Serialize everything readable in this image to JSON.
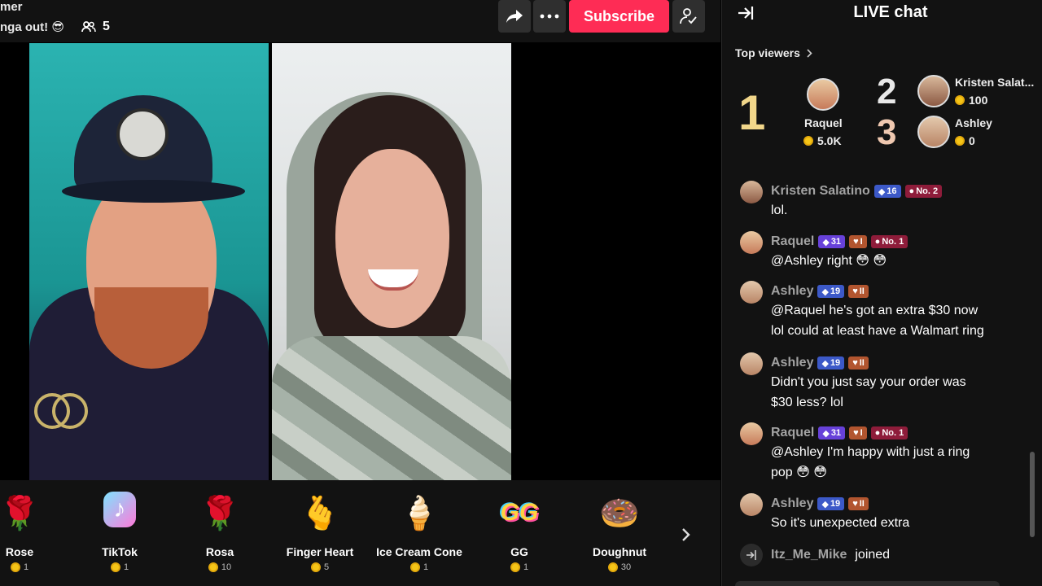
{
  "header": {
    "host_name": "mer",
    "stream_title": "nga out! 😎",
    "viewer_count": "5",
    "subscribe_label": "Subscribe"
  },
  "gifts": [
    {
      "icon": "🌹",
      "label": "Rose",
      "price": "1"
    },
    {
      "icon": "♪",
      "label": "TikTok",
      "price": "1"
    },
    {
      "icon": "🌹",
      "label": "Rosa",
      "price": "10"
    },
    {
      "icon": "🫰",
      "label": "Finger Heart",
      "price": "5"
    },
    {
      "icon": "🍦",
      "label": "Ice Cream Cone",
      "price": "1"
    },
    {
      "icon": "GG",
      "label": "GG",
      "price": "1"
    },
    {
      "icon": "🍩",
      "label": "Doughnut",
      "price": "30"
    }
  ],
  "chat": {
    "title": "LIVE chat",
    "top_viewers_label": "Top viewers",
    "top_viewers": [
      {
        "rank": "1",
        "name": "Raquel",
        "coins": "5.0K"
      },
      {
        "rank": "2",
        "name": "Kristen Salat...",
        "coins": "100"
      },
      {
        "rank": "3",
        "name": "Ashley",
        "coins": "0"
      }
    ],
    "messages": [
      {
        "user": "Kristen Salatino",
        "level": "16",
        "fan": "",
        "no": "No. 2",
        "lines": [
          "lol."
        ]
      },
      {
        "user": "Raquel",
        "level": "31",
        "fan": "I",
        "no": "No. 1",
        "lines": [
          "@Ashley right 😳 😳"
        ]
      },
      {
        "user": "Ashley",
        "level": "19",
        "fan": "II",
        "no": "",
        "lines": [
          "@Raquel he's got an extra $30 now",
          "lol could at least have a Walmart ring"
        ]
      },
      {
        "user": "Ashley",
        "level": "19",
        "fan": "II",
        "no": "",
        "lines": [
          "Didn't you just say your order was",
          "$30 less? lol"
        ]
      },
      {
        "user": "Raquel",
        "level": "31",
        "fan": "I",
        "no": "No. 1",
        "lines": [
          "@Ashley I'm happy with just a ring",
          "pop 😳 😳"
        ]
      },
      {
        "user": "Ashley",
        "level": "19",
        "fan": "II",
        "no": "",
        "lines": [
          "So it's unexpected extra"
        ]
      }
    ],
    "join": {
      "user": "Itz_Me_Mike",
      "text": "joined"
    }
  },
  "colors": {
    "accent": "#fe2c55",
    "panel": "#121212",
    "coin": "#f5c518"
  }
}
